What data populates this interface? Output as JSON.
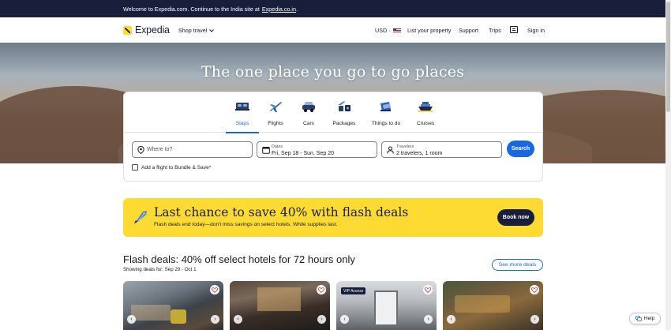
{
  "banner": {
    "text": "Welcome to Expedia.com. Continue to the India site at",
    "link": "Expedia.co.in",
    "suffix": "."
  },
  "header": {
    "logo": "Expedia",
    "shop_travel": "Shop travel",
    "currency": "USD",
    "list_property": "List your property",
    "support": "Support",
    "trips": "Trips",
    "sign_in": "Sign in"
  },
  "hero": {
    "title": "The one place you go to go places"
  },
  "search": {
    "tabs": [
      {
        "label": "Stays",
        "icon": "bed-icon"
      },
      {
        "label": "Flights",
        "icon": "plane-icon"
      },
      {
        "label": "Cars",
        "icon": "car-icon"
      },
      {
        "label": "Packages",
        "icon": "packages-icon"
      },
      {
        "label": "Things to do",
        "icon": "ticket-icon"
      },
      {
        "label": "Cruises",
        "icon": "ship-icon"
      }
    ],
    "active_tab": "Stays",
    "where_placeholder": "Where to?",
    "dates_label": "Dates",
    "dates_value": "Fri, Sep 18 - Sun, Sep 20",
    "travelers_label": "Travelers",
    "travelers_value": "2 travelers, 1 room",
    "search_button": "Search",
    "bundle_label": "Add a flight to Bundle & Save*"
  },
  "promo": {
    "title": "Last chance to save 40% with flash deals",
    "subtitle": "Flash deals end today—don't miss savings on select hotels. While supplies last.",
    "button": "Book now"
  },
  "deals": {
    "title": "Flash deals: 40% off select hotels for 72 hours only",
    "subtitle": "Showing deals for: Sep 29 - Oct 1",
    "see_more": "See more deals",
    "cards": [
      {
        "badge": ""
      },
      {
        "badge": ""
      },
      {
        "badge": "VIP Access"
      },
      {
        "badge": ""
      }
    ]
  },
  "help": {
    "label": "Help"
  },
  "colors": {
    "brand_navy": "#191e3b",
    "accent_blue": "#1668e3",
    "promo_yellow": "#fddb32"
  }
}
